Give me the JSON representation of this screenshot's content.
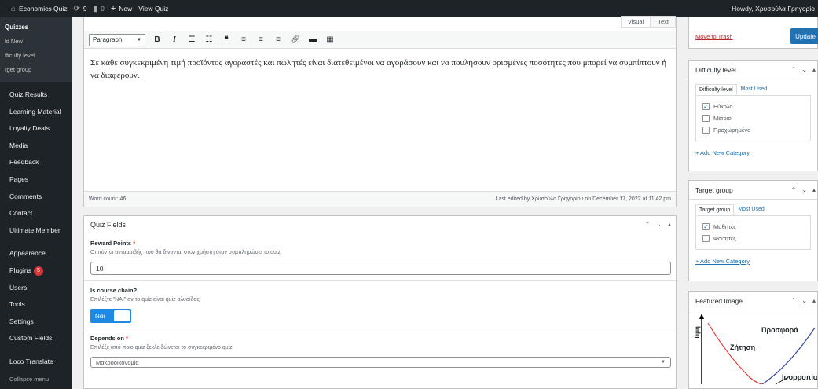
{
  "adminbar": {
    "site_name": "Economics Quiz",
    "updates_count": "9",
    "comments_count": "0",
    "new_label": "New",
    "view_label": "View Quiz",
    "howdy": "Howdy, Χρυσούλα Γρηγορίο"
  },
  "sidebar": {
    "submenu": [
      "Quizzes",
      "ld New",
      "fficulty level",
      "rget group"
    ],
    "items": [
      "Quiz Results",
      "Learning Material",
      "Loyalty Deals",
      "Media",
      "Feedback",
      "Pages",
      "Comments",
      "Contact",
      "Ultimate Member",
      "Appearance",
      "Plugins",
      "Users",
      "Tools",
      "Settings",
      "Custom Fields",
      "Loco Translate",
      "Collapse menu"
    ],
    "plugins_badge": "5"
  },
  "editor": {
    "tab_visual": "Visual",
    "tab_text": "Text",
    "format_select": "Paragraph",
    "content": "Σε κάθε συγκεκριμένη τιμή προϊόντος αγοραστές και πωλητές είναι διατεθειμένοι να αγοράσουν και να πουλήσουν ορισμένες ποσότητες που μπορεί να συμπίπτουν ή να διαφέρουν.",
    "word_count": "Word count: 46",
    "last_edited": "Last edited by Χρυσούλα Γρηγορίου on December 17, 2022 at 11:42 pm"
  },
  "quiz_fields": {
    "title": "Quiz Fields",
    "reward": {
      "label": "Reward Points",
      "required": "*",
      "desc": "Οι πόντοι ανταμοιβής που θα δίνονται στον χρήστη όταν συμπληρώσει το quiz",
      "value": "10"
    },
    "chain": {
      "label": "Is course chain?",
      "desc": "Επιλέξτε \"ΝΑΙ\" αν το quiz είναι quiz αλυσίδας",
      "toggle_label": "Ναι"
    },
    "depends": {
      "label": "Depends on",
      "required": "*",
      "desc": "Επιλέξε από ποιο quiz ξεκλειδώνεται το συγκεκριμένο quiz",
      "value": "Μακροοικονομία"
    }
  },
  "publish": {
    "trash": "Move to Trash",
    "update": "Update"
  },
  "difficulty": {
    "title": "Difficulty level",
    "tab_all": "Difficulty level",
    "tab_used": "Most Used",
    "options": [
      {
        "label": "Εύκολο",
        "checked": true
      },
      {
        "label": "Μέτριο",
        "checked": false
      },
      {
        "label": "Προχωρημένο",
        "checked": false
      }
    ],
    "add_new": "+ Add New Category"
  },
  "target": {
    "title": "Target group",
    "tab_all": "Target group",
    "tab_used": "Most Used",
    "options": [
      {
        "label": "Μαθητές",
        "checked": true
      },
      {
        "label": "Φοιτητές",
        "checked": false
      }
    ],
    "add_new": "+ Add New Category"
  },
  "featured": {
    "title": "Featured Image",
    "y_label": "Τιμή",
    "supply_label": "Προσφορά",
    "demand_label": "Ζήτηση",
    "equilibrium_label": "Ισορροπία"
  },
  "colors": {
    "admin_dark": "#1d2327",
    "accent_blue": "#2271b1",
    "toggle_blue": "#1e88e5",
    "badge_red": "#d63638",
    "demand_curve": "#e53935",
    "supply_curve": "#3949ab"
  }
}
